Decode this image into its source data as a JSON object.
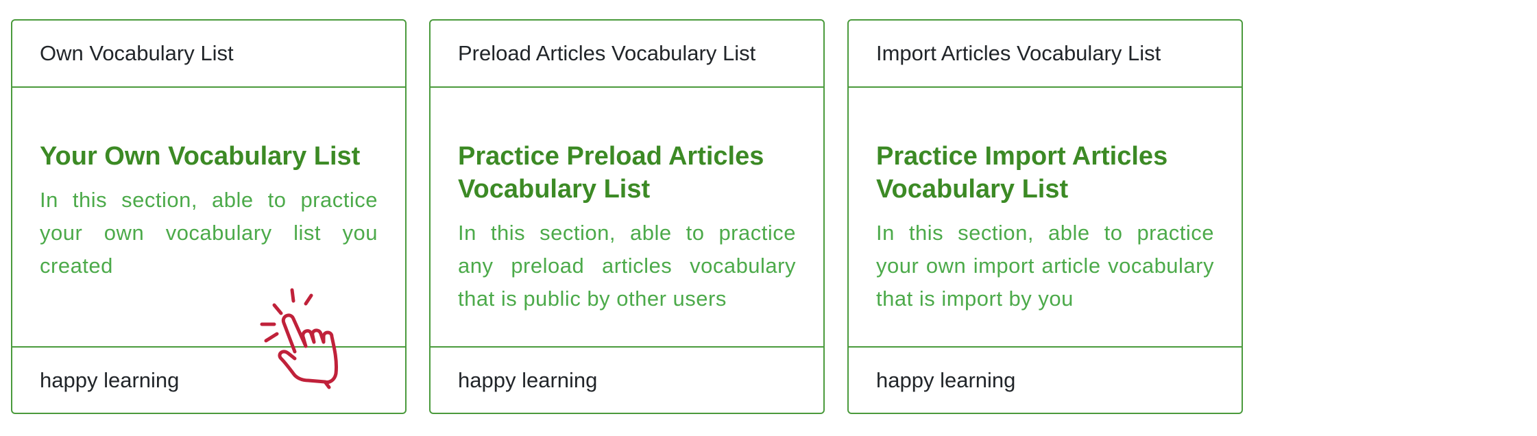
{
  "cards": [
    {
      "header": "Own Vocabulary List",
      "title": "Your Own Vocabulary List",
      "text": "In this section, able to practice your own vocabulary list you created",
      "footer": "happy learning"
    },
    {
      "header": "Preload Articles Vocabulary List",
      "title": "Practice Preload Articles Vocabulary List",
      "text": "In this section, able to practice any preload articles vocabulary that is public by other users",
      "footer": "happy learning"
    },
    {
      "header": "Import Articles Vocabulary List",
      "title": "Practice Import Articles Vocabulary List",
      "text": "In this section, able to practice your own import article vocabulary that is import by you",
      "footer": "happy learning"
    }
  ],
  "colors": {
    "border": "#4a9a3c",
    "title": "#3c8a25",
    "text": "#4caa4a",
    "pointer": "#c0213a"
  },
  "icons": {
    "pointer": "hand-pointer-click-icon"
  }
}
